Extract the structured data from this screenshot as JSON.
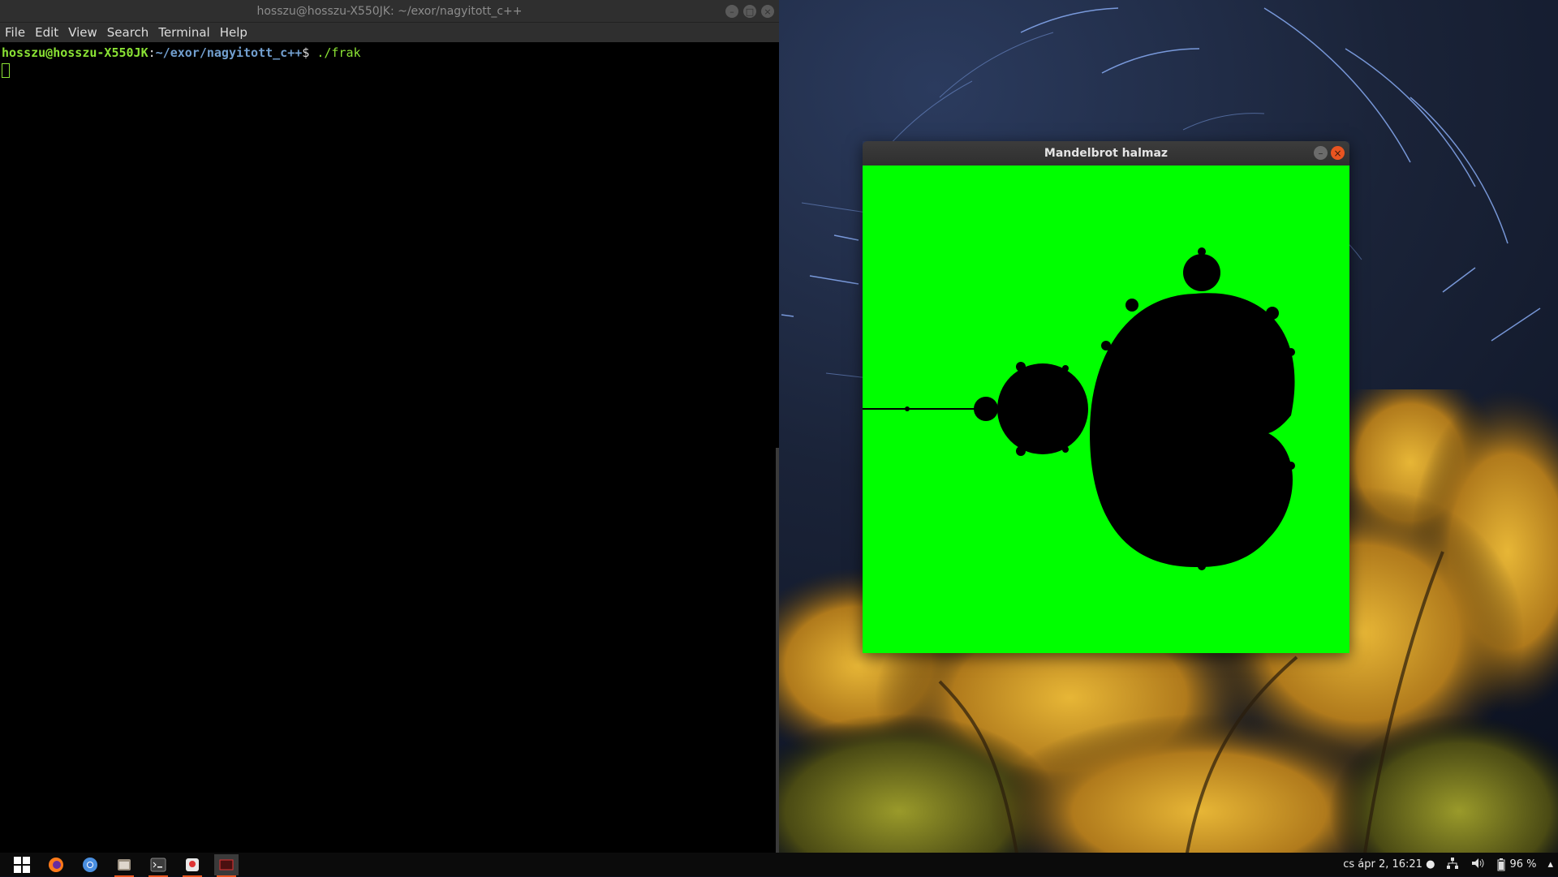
{
  "terminal": {
    "title": "hosszu@hosszu-X550JK: ~/exor/nagyitott_c++",
    "menu": [
      "File",
      "Edit",
      "View",
      "Search",
      "Terminal",
      "Help"
    ],
    "prompt_user": "hosszu@hosszu-X550JK",
    "prompt_sep": ":",
    "prompt_path": "~/exor/nagyitott_c++",
    "prompt_symbol": "$",
    "command": " ./frak"
  },
  "mandel_window": {
    "title": "Mandelbrot halmaz",
    "bg_color": "#00ff00",
    "set_color": "#000000"
  },
  "taskbar": {
    "apps": [
      "windows-icon",
      "firefox-icon",
      "chrome-icon",
      "files-icon",
      "terminal-icon",
      "app-icon",
      "window-icon"
    ],
    "clock": "cs ápr  2, 16:21 ●",
    "battery": "96 %"
  },
  "colors": {
    "accent": "#e95420",
    "prompt_green": "#8ae234",
    "prompt_blue": "#729fcf"
  }
}
